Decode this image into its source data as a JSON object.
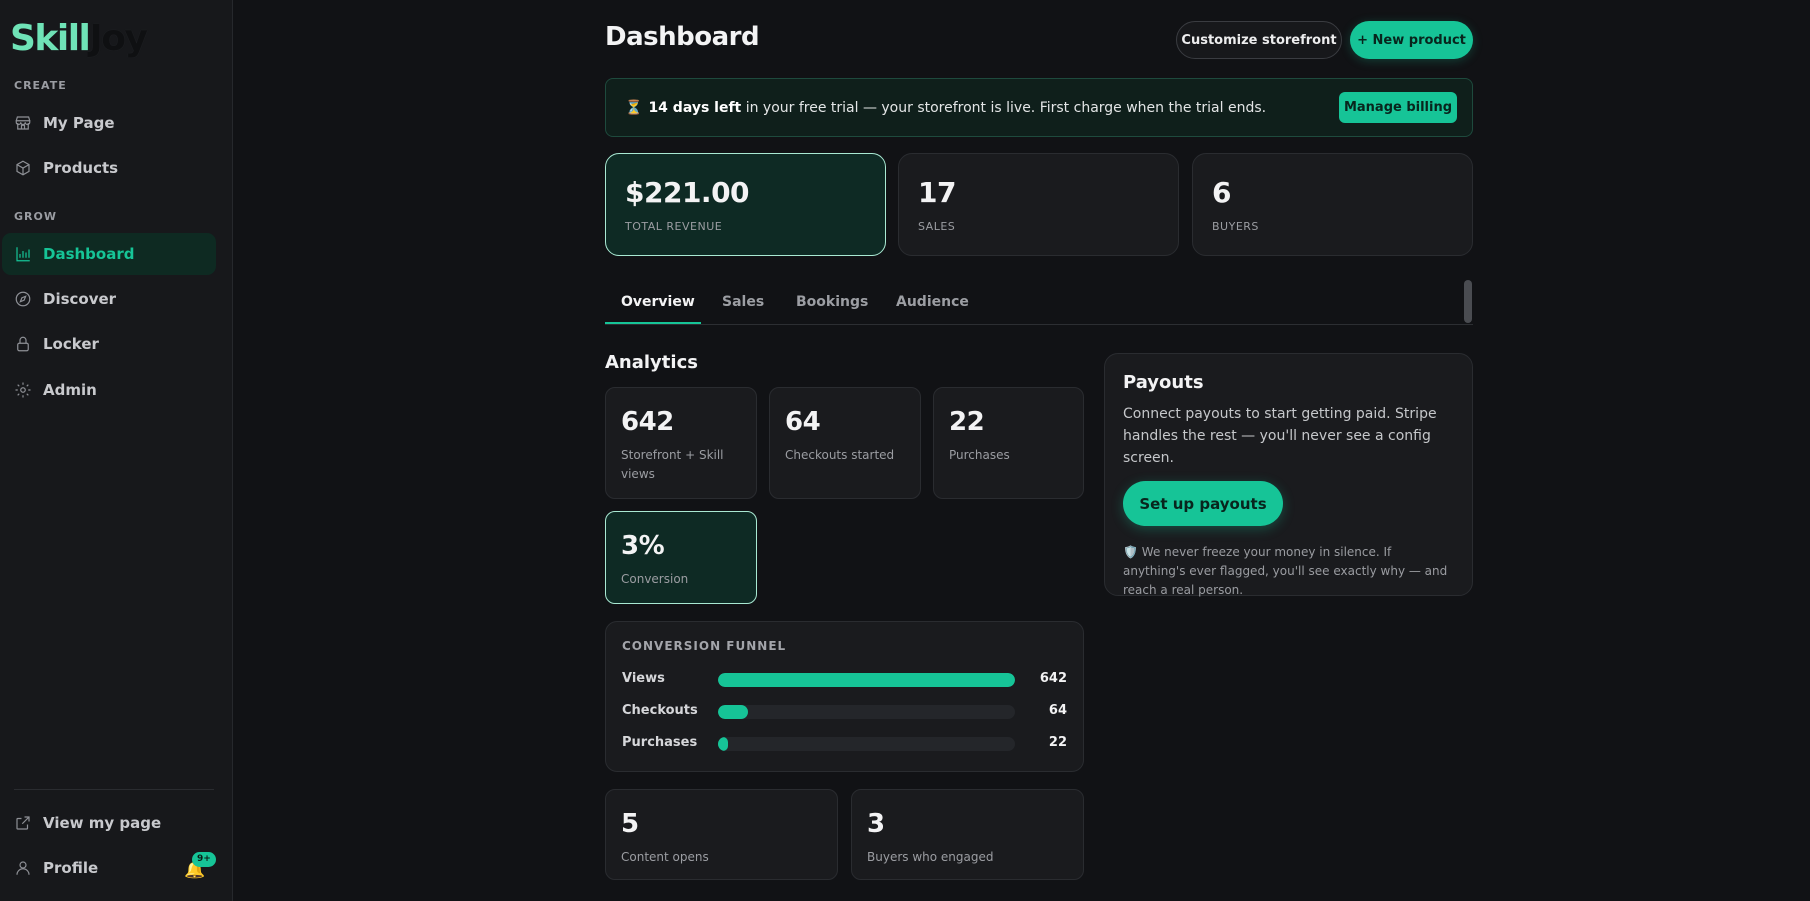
{
  "sidebar": {
    "logo": {
      "part1": "Skill",
      "part2": "Joy"
    },
    "section_create": "CREATE",
    "section_grow": "GROW",
    "items": [
      {
        "label": "My Page",
        "icon": "store-icon"
      },
      {
        "label": "Products",
        "icon": "box-icon"
      },
      {
        "label": "Dashboard",
        "icon": "bar-chart-icon",
        "active": true
      },
      {
        "label": "Discover",
        "icon": "compass-icon"
      },
      {
        "label": "Locker",
        "icon": "lock-icon"
      },
      {
        "label": "Admin",
        "icon": "gear-icon"
      }
    ],
    "bottom": [
      {
        "label": "View my page",
        "icon": "external-link-icon"
      },
      {
        "label": "Profile",
        "icon": "user-icon"
      }
    ],
    "notification_badge": "9+"
  },
  "header": {
    "title": "Dashboard",
    "customize_label": "Customize storefront",
    "new_product_label": "+ New product"
  },
  "trial": {
    "icon": "⏳",
    "bold": "14 days left",
    "text": " in your free trial — your storefront is live. First charge when the trial ends.",
    "button": "Manage billing"
  },
  "stats": [
    {
      "value": "$221.00",
      "label": "TOTAL REVENUE"
    },
    {
      "value": "17",
      "label": "SALES"
    },
    {
      "value": "6",
      "label": "BUYERS"
    }
  ],
  "tabs": [
    "Overview",
    "Sales",
    "Bookings",
    "Audience"
  ],
  "analytics": {
    "title": "Analytics",
    "cards": [
      {
        "value": "642",
        "label": "Storefront + Skill views"
      },
      {
        "value": "64",
        "label": "Checkouts started"
      },
      {
        "value": "22",
        "label": "Purchases"
      },
      {
        "value": "3%",
        "label": "Conversion"
      }
    ],
    "funnel": {
      "title": "CONVERSION FUNNEL",
      "rows": [
        {
          "label": "Views",
          "value": "642",
          "fraction": 1.0
        },
        {
          "label": "Checkouts",
          "value": "64",
          "fraction": 0.1
        },
        {
          "label": "Purchases",
          "value": "22",
          "fraction": 0.034
        }
      ]
    },
    "bottom_cards": [
      {
        "value": "5",
        "label": "Content opens"
      },
      {
        "value": "3",
        "label": "Buyers who engaged"
      }
    ]
  },
  "payouts": {
    "title": "Payouts",
    "description": "Connect payouts to start getting paid. Stripe handles the rest — you'll never see a config screen.",
    "button": "Set up payouts",
    "note_icon": "🛡️",
    "note": "We never freeze your money in silence. If anything's ever flagged, you'll see exactly why — and reach a real person."
  },
  "colors": {
    "accent": "#16c497",
    "background": "#111215",
    "sidebar": "#17181b"
  }
}
